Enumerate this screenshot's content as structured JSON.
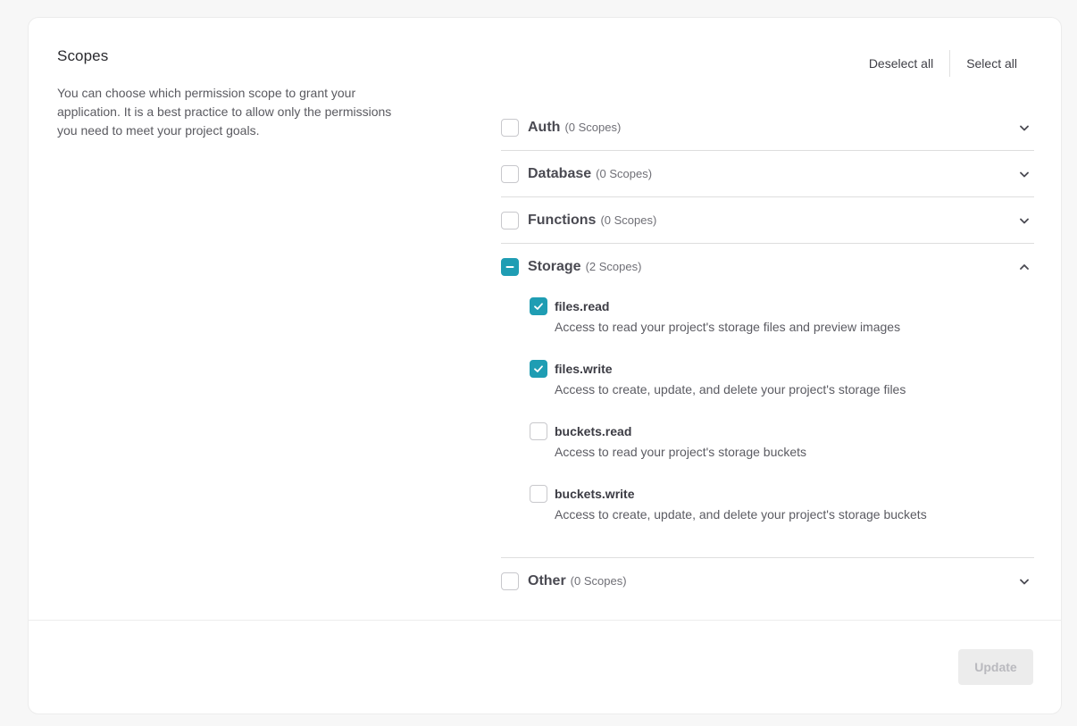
{
  "section": {
    "title": "Scopes",
    "description": "You can choose which permission scope to grant your application. It is a best practice to allow only the permissions you need to meet your project goals."
  },
  "actions": {
    "deselect_all": "Deselect all",
    "select_all": "Select all"
  },
  "groups": [
    {
      "name": "Auth",
      "count": "(0 Scopes)",
      "state": "unchecked",
      "expanded": false
    },
    {
      "name": "Database",
      "count": "(0 Scopes)",
      "state": "unchecked",
      "expanded": false
    },
    {
      "name": "Functions",
      "count": "(0 Scopes)",
      "state": "unchecked",
      "expanded": false
    },
    {
      "name": "Storage",
      "count": "(2 Scopes)",
      "state": "partial",
      "expanded": true,
      "items": [
        {
          "name": "files.read",
          "description": "Access to read your project's storage files and preview images",
          "checked": true
        },
        {
          "name": "files.write",
          "description": "Access to create, update, and delete your project's storage files",
          "checked": true
        },
        {
          "name": "buckets.read",
          "description": "Access to read your project's storage buckets",
          "checked": false
        },
        {
          "name": "buckets.write",
          "description": "Access to create, update, and delete your project's storage buckets",
          "checked": false
        }
      ]
    },
    {
      "name": "Other",
      "count": "(0 Scopes)",
      "state": "unchecked",
      "expanded": false
    }
  ],
  "footer": {
    "update_label": "Update",
    "update_disabled": true
  },
  "colors": {
    "accent": "#1f9db3",
    "update_disabled_bg": "#ececec"
  },
  "icons": {
    "check": "check-icon",
    "partial": "minus-icon",
    "collapsed": "chevron-down-icon",
    "expanded": "chevron-up-icon"
  }
}
